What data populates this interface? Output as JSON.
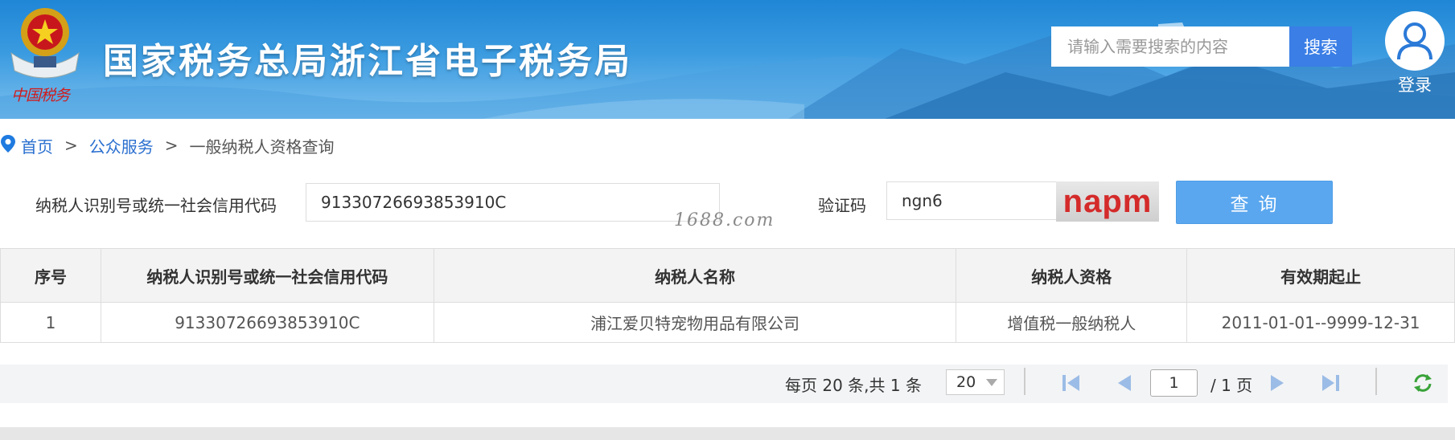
{
  "header": {
    "site_title": "国家税务总局浙江省电子税务局",
    "emblem_caption": "中国税务",
    "search_placeholder": "请输入需要搜索的内容",
    "search_button": "搜索",
    "login_label": "登录"
  },
  "breadcrumb": {
    "home": "首页",
    "separator": ">",
    "section": "公众服务",
    "current": "一般纳税人资格查询"
  },
  "form": {
    "taxid_label": "纳税人识别号或统一社会信用代码",
    "taxid_value": "91330726693853910C",
    "captcha_label": "验证码",
    "captcha_value": "ngn6",
    "captcha_image_text": "napm",
    "query_button": "查询",
    "watermark": "1688.com"
  },
  "table": {
    "headers": [
      "序号",
      "纳税人识别号或统一社会信用代码",
      "纳税人名称",
      "纳税人资格",
      "有效期起止"
    ],
    "rows": [
      [
        "1",
        "91330726693853910C",
        "浦江爱贝特宠物用品有限公司",
        "增值税一般纳税人",
        "2011-01-01--9999-12-31"
      ]
    ]
  },
  "pager": {
    "info": "每页 20 条,共 1 条",
    "page_size": "20",
    "current_page": "1",
    "total_pages": "/ 1 页"
  },
  "colors": {
    "header_blue": "#1f86d6",
    "search_button": "#3a7ee6",
    "query_button": "#5aa7ef",
    "link": "#2a6fcf"
  }
}
